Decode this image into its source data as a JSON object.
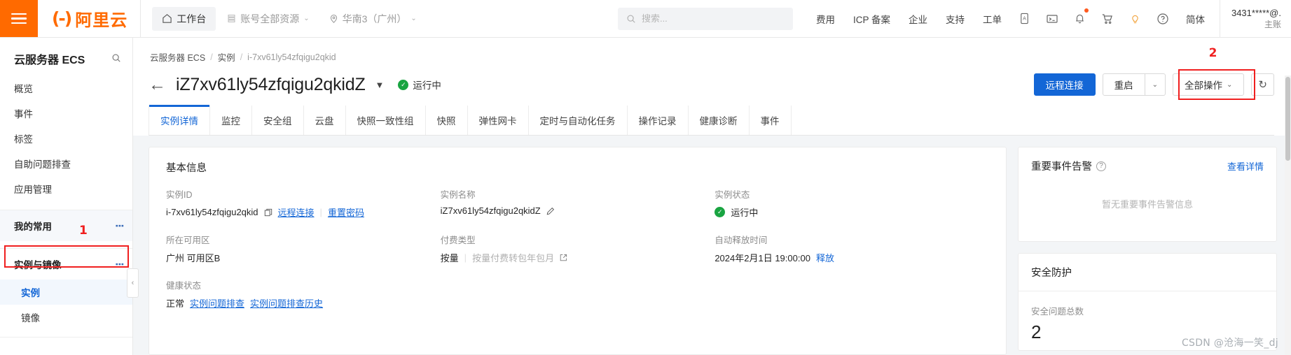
{
  "topbar": {
    "menu_icon": "hamburger-icon",
    "logo_mark": "(-)",
    "logo_text": "阿里云",
    "workbench": "工作台",
    "resource_scope": "账号全部资源",
    "region": "华南3（广州）",
    "search_placeholder": "搜索...",
    "nav_right": [
      "费用",
      "ICP 备案",
      "企业",
      "支持",
      "工单"
    ],
    "icons": [
      "app-icon",
      "terminal-icon",
      "bell-icon",
      "cart-icon",
      "bulb-icon",
      "help-icon"
    ],
    "language": "简体",
    "account_id": "3431*****@.",
    "account_role": "主账"
  },
  "sidebar": {
    "title": "云服务器 ECS",
    "search_icon": "search-icon",
    "links": [
      "概览",
      "事件",
      "标签",
      "自助问题排查",
      "应用管理"
    ],
    "group_favorites": "我的常用",
    "group_instances": "实例与镜像",
    "sub_items": [
      {
        "label": "实例",
        "active": true
      },
      {
        "label": "镜像",
        "active": false
      }
    ],
    "marker_1": "1",
    "collapse_icon": "chevron-left-icon"
  },
  "breadcrumb": {
    "root": "云服务器 ECS",
    "level2": "实例",
    "current": "i-7xv61ly54zfqigu2qkid",
    "separator": "/"
  },
  "page_head": {
    "back_icon": "back-arrow-icon",
    "instance_name": "iZ7xv61ly54zfqigu2qkidZ",
    "dropdown_icon": "chevron-down-icon",
    "status": "运行中",
    "buttons": {
      "remote_connect": "远程连接",
      "restart": "重启",
      "restart_caret": "chevron-down-icon",
      "all_actions": "全部操作",
      "all_actions_caret": "chevron-down-icon",
      "refresh_icon": "refresh-icon"
    },
    "marker_2": "2"
  },
  "tabs": [
    {
      "label": "实例详情",
      "active": true
    },
    {
      "label": "监控",
      "active": false
    },
    {
      "label": "安全组",
      "active": false
    },
    {
      "label": "云盘",
      "active": false
    },
    {
      "label": "快照一致性组",
      "active": false
    },
    {
      "label": "快照",
      "active": false
    },
    {
      "label": "弹性网卡",
      "active": false
    },
    {
      "label": "定时与自动化任务",
      "active": false
    },
    {
      "label": "操作记录",
      "active": false
    },
    {
      "label": "健康诊断",
      "active": false
    },
    {
      "label": "事件",
      "active": false
    }
  ],
  "basic_info": {
    "title": "基本信息",
    "fields": [
      {
        "label": "实例ID",
        "value": "i-7xv61ly54zfqigu2qkid",
        "copy_icon": "copy-icon",
        "link1": "远程连接",
        "link2": "重置密码"
      },
      {
        "label": "实例名称",
        "value": "iZ7xv61ly54zfqigu2qkidZ",
        "edit_icon": "pencil-icon"
      },
      {
        "label": "实例状态",
        "value": "运行中",
        "status_icon": "check-circle-icon"
      },
      {
        "label": "所在可用区",
        "value": "广州 可用区B"
      },
      {
        "label": "付费类型",
        "value": "按量",
        "muted_link": "按量付费转包年包月",
        "external_icon": "external-link-icon"
      },
      {
        "label": "自动释放时间",
        "value": "2024年2月1日 19:00:00",
        "link1": "释放"
      },
      {
        "label": "健康状态",
        "value": "正常",
        "link1": "实例问题排查",
        "link2": "实例问题排查历史"
      }
    ]
  },
  "event_alarm_card": {
    "title": "重要事件告警",
    "help_icon": "question-circle-icon",
    "detail_link": "查看详情",
    "empty_text": "暂无重要事件告警信息"
  },
  "security_card": {
    "title": "安全防护",
    "metric_label": "安全问题总数",
    "metric_value": "2"
  },
  "watermark": "CSDN @沧海一笑_dj",
  "colors": {
    "brand_orange": "#ff6a00",
    "primary_blue": "#1366d6",
    "success_green": "#19a441",
    "marker_red": "#f01f1f"
  }
}
